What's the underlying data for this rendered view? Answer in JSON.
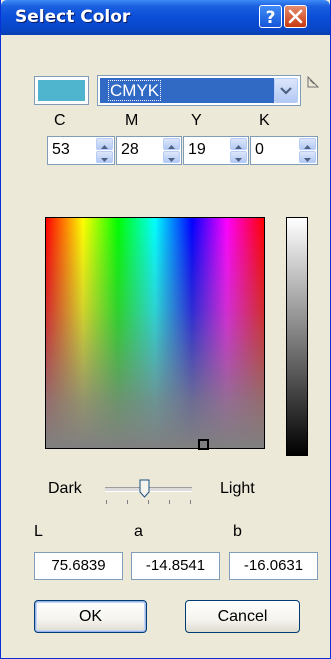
{
  "window": {
    "title": "Select Color"
  },
  "titlebar_buttons": {
    "help": "?",
    "close": "close-icon"
  },
  "current_color": "#4FB5CE",
  "mode_select": {
    "value": "CMYK"
  },
  "channels": [
    {
      "label": "C",
      "value": "53"
    },
    {
      "label": "M",
      "value": "28"
    },
    {
      "label": "Y",
      "value": "19"
    },
    {
      "label": "K",
      "value": "0"
    }
  ],
  "brightness": {
    "dark_label": "Dark",
    "light_label": "Light",
    "level": 0.45
  },
  "lab": [
    {
      "label": "L",
      "value": "75.6839"
    },
    {
      "label": "a",
      "value": "-14.8541"
    },
    {
      "label": "b",
      "value": "-16.0631"
    }
  ],
  "buttons": {
    "ok": "OK",
    "cancel": "Cancel"
  }
}
